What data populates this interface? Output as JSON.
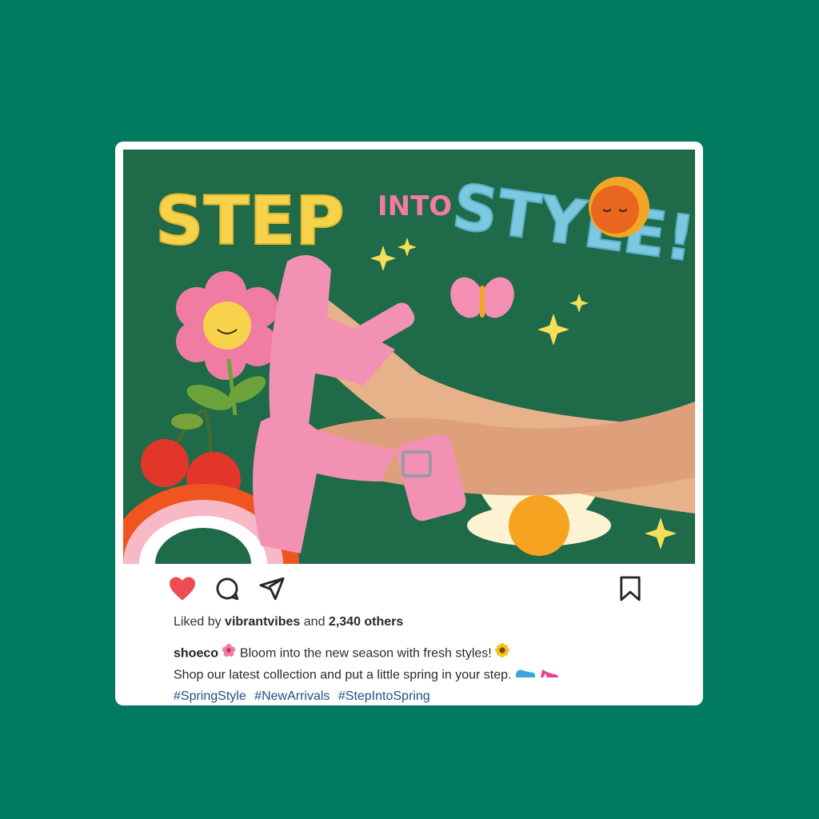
{
  "post": {
    "image": {
      "headline_step": "STEP",
      "headline_into": "INTO",
      "headline_style": "STYLE!"
    },
    "actions": {
      "like_icon": "heart-filled-icon",
      "comment_icon": "comment-icon",
      "share_icon": "send-icon",
      "save_icon": "bookmark-icon",
      "like_color": "#ef4b55"
    },
    "likes": {
      "prefix": "Liked by",
      "user": "vibrantvibes",
      "middle": "and",
      "count": "2,340 others"
    },
    "caption": {
      "username": "shoeco",
      "line1": "Bloom into the new season with fresh styles!",
      "line2": "Shop our latest collection and put a little spring in your step.",
      "hashtags": [
        "#SpringStyle",
        "#NewArrivals",
        "#StepIntoSpring"
      ]
    }
  }
}
